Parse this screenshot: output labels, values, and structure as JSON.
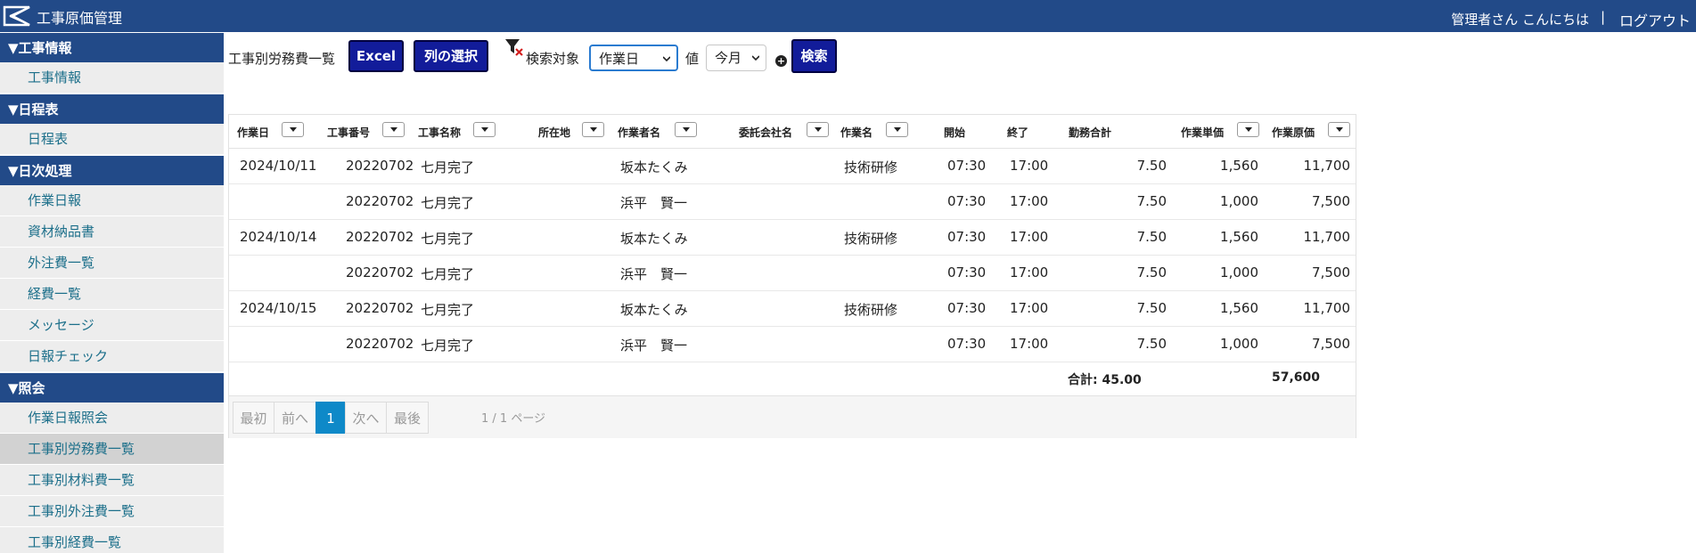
{
  "header": {
    "app_title": "工事原価管理",
    "greeting": "管理者さん こんにちは",
    "separator": "|",
    "logout": "ログアウト"
  },
  "sidebar": {
    "sections": [
      {
        "title": "▼工事情報",
        "items": [
          "工事情報"
        ]
      },
      {
        "title": "▼日程表",
        "items": [
          "日程表"
        ]
      },
      {
        "title": "▼日次処理",
        "items": [
          "作業日報",
          "資材納品書",
          "外注費一覧",
          "経費一覧",
          "メッセージ",
          "日報チェック"
        ]
      },
      {
        "title": "▼照会",
        "items": [
          "作業日報照会",
          "工事別労務費一覧",
          "工事別材料費一覧",
          "工事別外注費一覧",
          "工事別経費一覧"
        ]
      }
    ],
    "active_item": "工事別労務費一覧"
  },
  "toolbar": {
    "page_title": "工事別労務費一覧",
    "excel_label": "Excel",
    "columns_label": "列の選択",
    "search_target_label": "検索対象",
    "search_target_value": "作業日",
    "value_label": "値",
    "value_value": "今月",
    "search_label": "検索"
  },
  "grid": {
    "columns": [
      "作業日",
      "工事番号",
      "工事名称",
      "所在地",
      "作業者名",
      "委託会社名",
      "作業名",
      "開始",
      "終了",
      "勤務合計",
      "作業単価",
      "作業原価"
    ],
    "rows": [
      {
        "date": "2024/10/11",
        "no": "20220702",
        "name": "七月完了",
        "location": "",
        "worker": "坂本たくみ",
        "company": "",
        "task": "技術研修",
        "start": "07:30",
        "end": "17:00",
        "hours": "7.50",
        "unit": "1,560",
        "cost": "11,700"
      },
      {
        "date": "",
        "no": "20220702",
        "name": "七月完了",
        "location": "",
        "worker": "浜平　賢一",
        "company": "",
        "task": "",
        "start": "07:30",
        "end": "17:00",
        "hours": "7.50",
        "unit": "1,000",
        "cost": "7,500"
      },
      {
        "date": "2024/10/14",
        "no": "20220702",
        "name": "七月完了",
        "location": "",
        "worker": "坂本たくみ",
        "company": "",
        "task": "技術研修",
        "start": "07:30",
        "end": "17:00",
        "hours": "7.50",
        "unit": "1,560",
        "cost": "11,700"
      },
      {
        "date": "",
        "no": "20220702",
        "name": "七月完了",
        "location": "",
        "worker": "浜平　賢一",
        "company": "",
        "task": "",
        "start": "07:30",
        "end": "17:00",
        "hours": "7.50",
        "unit": "1,000",
        "cost": "7,500"
      },
      {
        "date": "2024/10/15",
        "no": "20220702",
        "name": "七月完了",
        "location": "",
        "worker": "坂本たくみ",
        "company": "",
        "task": "技術研修",
        "start": "07:30",
        "end": "17:00",
        "hours": "7.50",
        "unit": "1,560",
        "cost": "11,700"
      },
      {
        "date": "",
        "no": "20220702",
        "name": "七月完了",
        "location": "",
        "worker": "浜平　賢一",
        "company": "",
        "task": "",
        "start": "07:30",
        "end": "17:00",
        "hours": "7.50",
        "unit": "1,000",
        "cost": "7,500"
      }
    ],
    "total_hours": "合計: 45.00",
    "total_cost": "57,600"
  },
  "pager": {
    "first": "最初",
    "prev": "前へ",
    "current": "1",
    "next": "次へ",
    "last": "最後",
    "info": "1 / 1 ページ"
  },
  "colors": {
    "header_bg": "#224a88",
    "button_bg": "#121c9a",
    "link": "#1c6f8a",
    "pager_current": "#0e89c8"
  }
}
